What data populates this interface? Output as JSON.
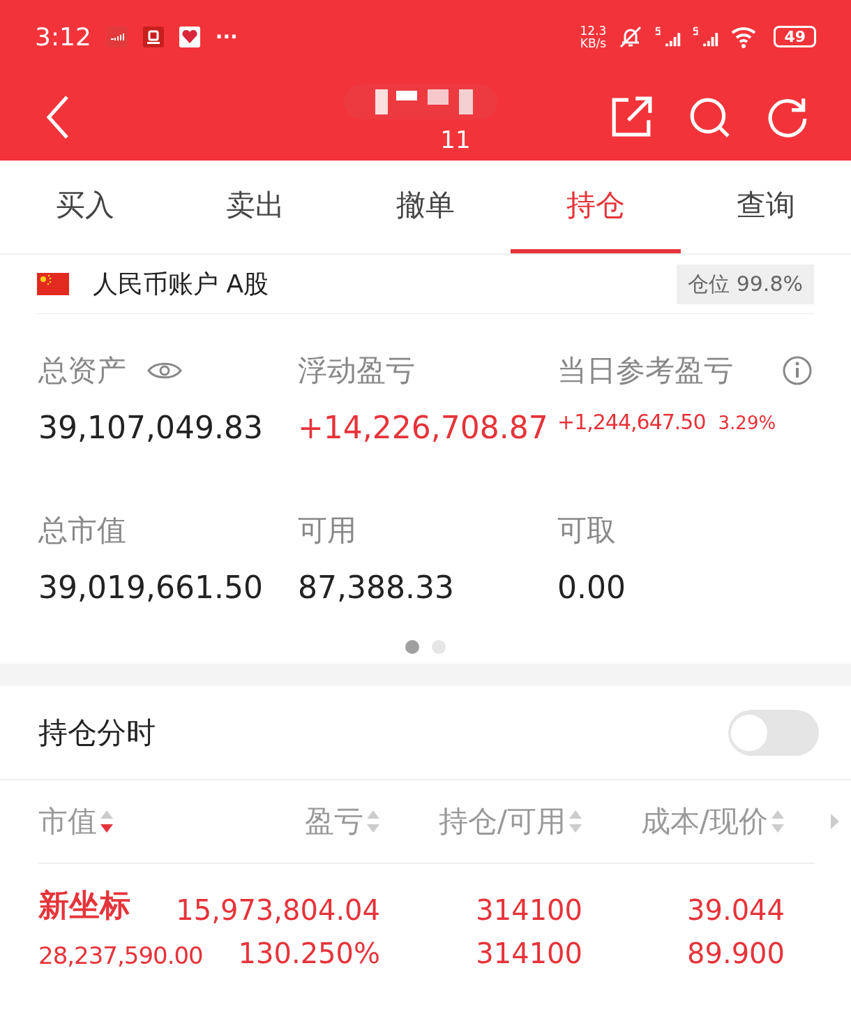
{
  "status_bar": {
    "time": "3:12",
    "more": "···",
    "speed_value": "12.3",
    "speed_unit": "KB/s",
    "battery": "49"
  },
  "header": {
    "subtitle": "11"
  },
  "tabs": [
    {
      "label": "买入",
      "selected": false
    },
    {
      "label": "卖出",
      "selected": false
    },
    {
      "label": "撤单",
      "selected": false
    },
    {
      "label": "持仓",
      "selected": true
    },
    {
      "label": "查询",
      "selected": false
    }
  ],
  "account": {
    "name": "人民币账户 A股",
    "position": "仓位 99.8%"
  },
  "stats": [
    {
      "label": "总资产",
      "kind": "eye",
      "value": "39,107,049.83",
      "gain": false
    },
    {
      "label": "浮动盈亏",
      "kind": "plain",
      "value": "+14,226,708.87",
      "gain": true
    },
    {
      "label": "当日参考盈亏",
      "kind": "info",
      "value": "+1,244,647.50",
      "extra": "3.29%",
      "gain": true
    },
    {
      "label": "总市值",
      "kind": "plain",
      "value": "39,019,661.50",
      "gain": false
    },
    {
      "label": "可用",
      "kind": "plain",
      "value": "87,388.33",
      "gain": false
    },
    {
      "label": "可取",
      "kind": "plain",
      "value": "0.00",
      "gain": false
    }
  ],
  "pages": [
    {
      "selected": true
    },
    {
      "selected": false
    }
  ],
  "timeshare": {
    "label": "持仓分时",
    "on": false
  },
  "columns": [
    {
      "label": "市值",
      "sorted": true
    },
    {
      "label": "盈亏",
      "sorted": false
    },
    {
      "label": "持仓/可用",
      "sorted": false
    },
    {
      "label": "成本/现价",
      "sorted": false
    }
  ],
  "rows": [
    {
      "name": "新坐标",
      "market_value": "28,237,590.00",
      "profit": "15,973,804.04",
      "profit_pct": "130.250%",
      "holding": "314100",
      "available": "314100",
      "cost": "39.044",
      "price": "89.900"
    }
  ]
}
